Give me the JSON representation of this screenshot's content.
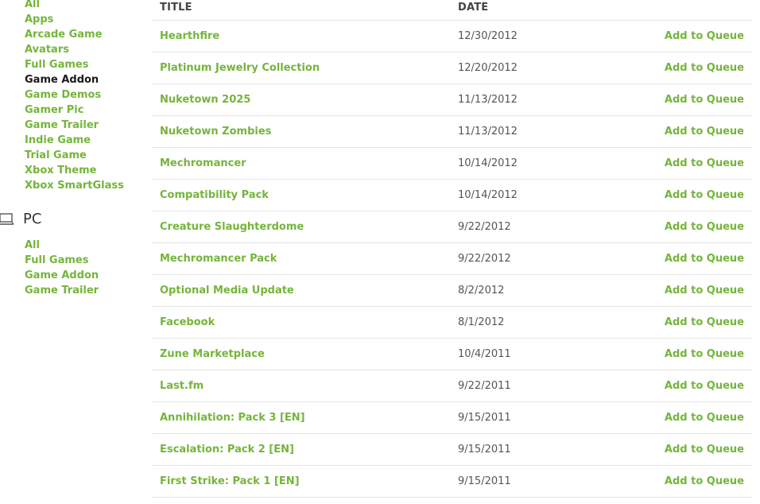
{
  "sidebar": {
    "xbox_items": [
      {
        "label": "All",
        "active": false
      },
      {
        "label": "Apps",
        "active": false
      },
      {
        "label": "Arcade Game",
        "active": false
      },
      {
        "label": "Avatars",
        "active": false
      },
      {
        "label": "Full Games",
        "active": false
      },
      {
        "label": "Game Addon",
        "active": true
      },
      {
        "label": "Game Demos",
        "active": false
      },
      {
        "label": "Gamer Pic",
        "active": false
      },
      {
        "label": "Game Trailer",
        "active": false
      },
      {
        "label": "Indie Game",
        "active": false
      },
      {
        "label": "Trial Game",
        "active": false
      },
      {
        "label": "Xbox Theme",
        "active": false
      },
      {
        "label": "Xbox SmartGlass",
        "active": false
      }
    ],
    "pc_section": {
      "label": "PC",
      "icon": "laptop-icon",
      "items": [
        {
          "label": "All"
        },
        {
          "label": "Full Games"
        },
        {
          "label": "Game Addon"
        },
        {
          "label": "Game Trailer"
        }
      ]
    }
  },
  "table": {
    "headers": {
      "title": "TITLE",
      "date": "DATE"
    },
    "rows": [
      {
        "title": "Hearthfire",
        "date": "12/30/2012",
        "action": "Add to Queue"
      },
      {
        "title": "Platinum Jewelry Collection",
        "date": "12/20/2012",
        "action": "Add to Queue"
      },
      {
        "title": "Nuketown 2025",
        "date": "11/13/2012",
        "action": "Add to Queue"
      },
      {
        "title": "Nuketown Zombies",
        "date": "11/13/2012",
        "action": "Add to Queue"
      },
      {
        "title": "Mechromancer",
        "date": "10/14/2012",
        "action": "Add to Queue"
      },
      {
        "title": "Compatibility Pack",
        "date": "10/14/2012",
        "action": "Add to Queue"
      },
      {
        "title": "Creature Slaughterdome",
        "date": "9/22/2012",
        "action": "Add to Queue"
      },
      {
        "title": "Mechromancer Pack",
        "date": "9/22/2012",
        "action": "Add to Queue"
      },
      {
        "title": "Optional Media Update",
        "date": "8/2/2012",
        "action": "Add to Queue"
      },
      {
        "title": "Facebook",
        "date": "8/1/2012",
        "action": "Add to Queue"
      },
      {
        "title": "Zune Marketplace",
        "date": "10/4/2011",
        "action": "Add to Queue"
      },
      {
        "title": "Last.fm",
        "date": "9/22/2011",
        "action": "Add to Queue"
      },
      {
        "title": "Annihilation: Pack 3 [EN]",
        "date": "9/15/2011",
        "action": "Add to Queue"
      },
      {
        "title": "Escalation: Pack 2 [EN]",
        "date": "9/15/2011",
        "action": "Add to Queue"
      },
      {
        "title": "First Strike: Pack 1 [EN]",
        "date": "9/15/2011",
        "action": "Add to Queue"
      }
    ]
  },
  "colors": {
    "link_green": "#74b53a",
    "active_text": "#1a1a1a",
    "divider": "#e6e6e6"
  }
}
